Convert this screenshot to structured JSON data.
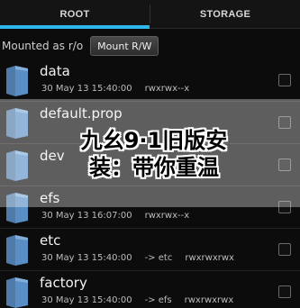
{
  "tabs": [
    {
      "label": "ROOT",
      "active": true
    },
    {
      "label": "STORAGE",
      "active": false
    }
  ],
  "mount": {
    "status": "Mounted as r/o",
    "button_label": "Mount R/W"
  },
  "files": [
    {
      "name": "data",
      "date": "30 May 13 15:40:00",
      "perms": "rwxrwx--x",
      "link": ""
    },
    {
      "name": "default.prop",
      "date": "",
      "perms": "",
      "link": ""
    },
    {
      "name": "dev",
      "date": "",
      "perms": "",
      "link": ""
    },
    {
      "name": "efs",
      "date": "30 May 13 16:07:00",
      "perms": "rwxrwx--x",
      "link": ""
    },
    {
      "name": "etc",
      "date": "30 May 13 15:40:00",
      "perms": "rwxrwxrwx",
      "link": "-> etc"
    },
    {
      "name": "factory",
      "date": "30 May 13 15:40:00",
      "perms": "rwxrwxrwx",
      "link": "-> efs"
    }
  ],
  "banner": {
    "line1": "九幺9·1旧版安",
    "line2": "装：带你重温"
  },
  "colors": {
    "tab_indicator": "#2fb6ea",
    "folder": "#5a8fc6",
    "background": "#0c0c0c"
  },
  "icons": {
    "folder": "folder-icon",
    "checkbox": "checkbox-icon"
  }
}
